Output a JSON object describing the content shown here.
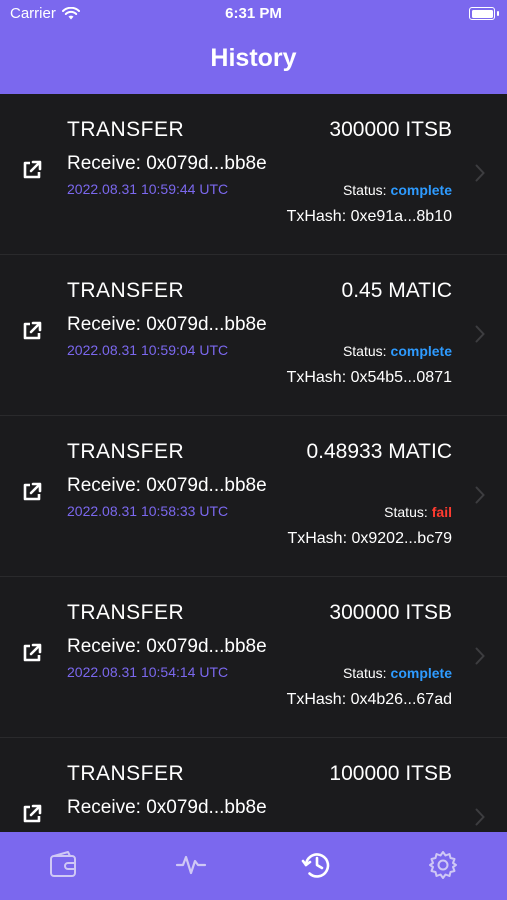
{
  "status_bar": {
    "carrier": "Carrier",
    "time": "6:31 PM"
  },
  "header": {
    "title": "History"
  },
  "rows": [
    {
      "type": "TRANSFER",
      "amount": "300000 ITSB",
      "receive": "Receive: 0x079d...bb8e",
      "date": "2022.08.31 10:59:44 UTC",
      "status_label": "Status:",
      "status_value": "complete",
      "txhash": "TxHash: 0xe91a...8b10"
    },
    {
      "type": "TRANSFER",
      "amount": "0.45 MATIC",
      "receive": "Receive: 0x079d...bb8e",
      "date": "2022.08.31 10:59:04 UTC",
      "status_label": "Status:",
      "status_value": "complete",
      "txhash": "TxHash: 0x54b5...0871"
    },
    {
      "type": "TRANSFER",
      "amount": "0.48933 MATIC",
      "receive": "Receive: 0x079d...bb8e",
      "date": "2022.08.31 10:58:33 UTC",
      "status_label": "Status:",
      "status_value": "fail",
      "txhash": "TxHash: 0x9202...bc79"
    },
    {
      "type": "TRANSFER",
      "amount": "300000 ITSB",
      "receive": "Receive: 0x079d...bb8e",
      "date": "2022.08.31 10:54:14 UTC",
      "status_label": "Status:",
      "status_value": "complete",
      "txhash": "TxHash: 0x4b26...67ad"
    },
    {
      "type": "TRANSFER",
      "amount": "100000 ITSB",
      "receive": "Receive: 0x079d...bb8e",
      "date": "",
      "status_label": "",
      "status_value": "",
      "txhash": ""
    }
  ],
  "tabs": [
    {
      "icon": "wallet-icon"
    },
    {
      "icon": "activity-icon"
    },
    {
      "icon": "history-icon",
      "active": true
    },
    {
      "icon": "settings-icon"
    }
  ],
  "colors": {
    "accent": "#7B68EE",
    "complete": "#2E9BFF",
    "fail": "#FF3B30",
    "row_bg": "#1B1B1D"
  }
}
